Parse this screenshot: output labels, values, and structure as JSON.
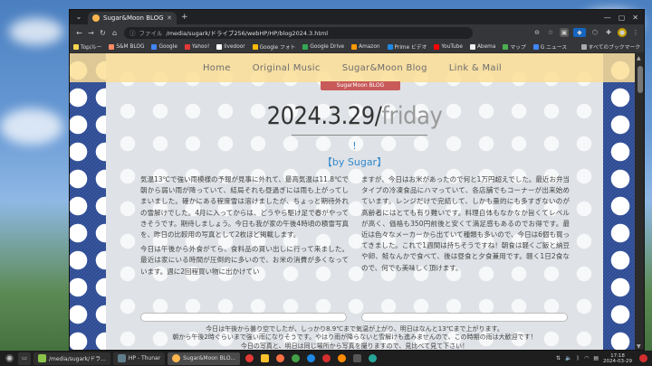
{
  "browser": {
    "tab_title": "Sugar&Moon BLOG",
    "new_tab_glyph": "+",
    "url_prefix": "ファイル",
    "url": "/media/sugark/ドライブ256/webHP/HP/blog2024.3.html",
    "bookmarks": [
      {
        "label": "Top/ルー",
        "color": "#ffd54f"
      },
      {
        "label": "S&M BLOG",
        "color": "#ff8a65"
      },
      {
        "label": "Google",
        "color": "#4285f4"
      },
      {
        "label": "Yahoo!",
        "color": "#e53935"
      },
      {
        "label": "livedoor",
        "color": "#ffffff"
      },
      {
        "label": "Google フォト",
        "color": "#fbbc05"
      },
      {
        "label": "Google Drive",
        "color": "#34a853"
      },
      {
        "label": "Amazon",
        "color": "#ff9900"
      },
      {
        "label": "Prime ビデオ",
        "color": "#1e88e5"
      },
      {
        "label": "YouTube",
        "color": "#ff0000"
      },
      {
        "label": "Abema",
        "color": "#eeeeee"
      },
      {
        "label": "マップ",
        "color": "#4caf50"
      },
      {
        "label": "G ニュース",
        "color": "#4285f4"
      }
    ],
    "all_bookmarks": "すべてのブックマーク",
    "icons": [
      "back-icon",
      "forward-icon",
      "reload-icon",
      "home-icon"
    ]
  },
  "site": {
    "nav": [
      "Home",
      "Original Music",
      "Sugar&Moon Blog",
      "Link & Mail"
    ],
    "badge": "SugarMoon BLOG"
  },
  "post": {
    "date": "2024.3.29/",
    "day": "friday",
    "excl": "!",
    "author": "【by Sugar】",
    "left_paragraphs": [
      "気温13℃で強い雨模様の予報が見事に外れて、最高気温は11.8℃で朝から弱い雨が降っていて、結局それも昼過ぎには雨も上がってしまいました。確かにある程度雪は溶けましたが、ちょっと期待外れの雪解けでした。4月に入ってからは、どうやら駆け足で春がやってきそうです。期待しましょう。今日も我が家の午後4時頃の積雪写真を、昨日の比較用の写真として2枚ほど掲載します。",
      "今日は午後から外食がてら、食料品の買い出しに行って来ました。最近は家にいる時間が圧倒的に多いので、お米の消費が多くなっています。週に2回程買い物に出かけてい"
    ],
    "right_paragraphs": [
      "ますが、今日はお米があったので何と1万円超えでした。最近お弁当タイプの冷凍食品にハマっていて、各店舗でもコーナーが出来始めています。レンジだけで完結して、しかも量的にも多すぎないのが高齢者にはとても有り難いです。料理自体もなかなか旨くてレベルが高く、価格も350円前後と安くて満足感もあるのでお得です。最近は色々なメーカーから出ていて種類も多いので、今日は6個も買ってきました。これで1週間は持ちそうですね！朝食は軽くご飯と納豆や卵、鮭なんかで食べて、後は昼食と夕食兼用です。軽く1日2食なので、何でも美味しく頂けます。"
    ],
    "footer_lines": [
      "今日は午後から曇り空でしたが、しっかり8.9℃まで気温が上がり、明日はなんと13℃まで上がります。",
      "朝から午後2時ぐらいまで強い雨になりそうです。やはり雨が降らないと雪解けも進みませんので、この時期の雨は大歓迎です！",
      "今日の写真と、明日は同じ場所から写真を撮りますので、見比べて見て下さい！"
    ]
  },
  "taskbar": {
    "windows": [
      {
        "label": "/media/sugark/ドラ...",
        "color": "#8bc34a"
      },
      {
        "label": "HP - Thunar",
        "color": "#607d8b"
      },
      {
        "label": "Sugar&Moon BLO...",
        "color": "#ffb74d"
      }
    ],
    "clock_time": "17:18",
    "clock_date": "2024-03-29"
  }
}
